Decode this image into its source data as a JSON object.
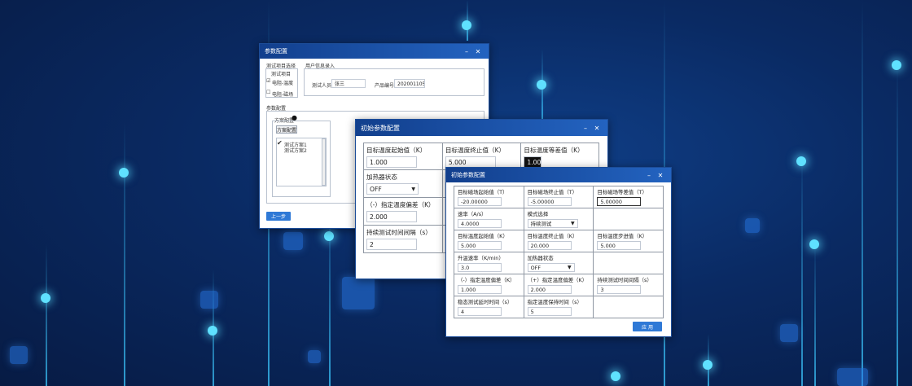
{
  "config_window": {
    "title": "参数配置",
    "test_select_label": "测试项目选择",
    "test_list_header": "测试项目",
    "test_items": [
      "电阻-温度",
      "电阻-磁场"
    ],
    "user_info_label": "用户信息录入",
    "tester_label": "测试人员",
    "tester_value": "张三",
    "product_no_label": "产品编号",
    "product_no_value": "202001105",
    "param_config_label": "参数配置",
    "scheme_label": "方案配置",
    "scheme_button": "方案配置",
    "schemes": [
      "测试方案1",
      "测试方案2"
    ],
    "back_button": "上一步"
  },
  "init_window_front": {
    "title": "初始参数配置",
    "fields": {
      "start_temp_label": "目标温度起始值（K）",
      "start_temp_value": "1.000",
      "end_temp_label": "目标温度终止值（K）",
      "end_temp_value": "5.000",
      "step_temp_label": "目标温度等差值（K）",
      "step_temp_value": "1.000",
      "heater_label": "加热器状态",
      "heater_value": "OFF",
      "deviation_label": "（-）指定温度偏差（K）",
      "deviation_value": "2.000",
      "interval_label": "持续测试时间间隔（s）",
      "interval_value": "2"
    }
  },
  "init_window_back": {
    "title": "初始参数配置",
    "fields": {
      "start_field_label": "目标磁场起始值（T）",
      "start_field_value": "-20.00000",
      "end_field_label": "目标磁场终止值（T）",
      "end_field_value": "-5.00000",
      "step_field_label": "目标磁场等差值（T）",
      "step_field_value": "5.00000",
      "rate_label": "速率（A/s）",
      "rate_value": "4.0000",
      "mode_label": "模式选择",
      "mode_value": "持续测试",
      "start_temp_label": "目标温度起始值（K）",
      "start_temp_value": "5.000",
      "end_temp_label": "目标温度终止值（K）",
      "end_temp_value": "20.000",
      "step_temp_label": "目标温度步进值（K）",
      "step_temp_value": "5.000",
      "heat_rate_label": "升温速率（K/min）",
      "heat_rate_value": "3.0",
      "heater_label": "加热器状态",
      "heater_value": "OFF",
      "neg_dev_label": "（-）指定温度偏差（K）",
      "neg_dev_value": "1.000",
      "pos_dev_label": "（+）指定温度偏差（K）",
      "pos_dev_value": "2.000",
      "interval_label": "持续测试时间间隔（s）",
      "interval_value": "3",
      "hold_label": "稳态测试延时时间（s）",
      "hold_value": "4",
      "keep_label": "指定温度保持时间（s）",
      "keep_value": "5"
    },
    "apply_button": "应 用"
  },
  "icons": {
    "minimize": "minimize-icon",
    "close": "close-icon",
    "checkbox": "checkbox-icon",
    "dropdown": "chevron-down-icon"
  },
  "colors": {
    "titlebar": "#1b4fa3",
    "accent": "#2f79d6",
    "background": "#0a2a63"
  }
}
